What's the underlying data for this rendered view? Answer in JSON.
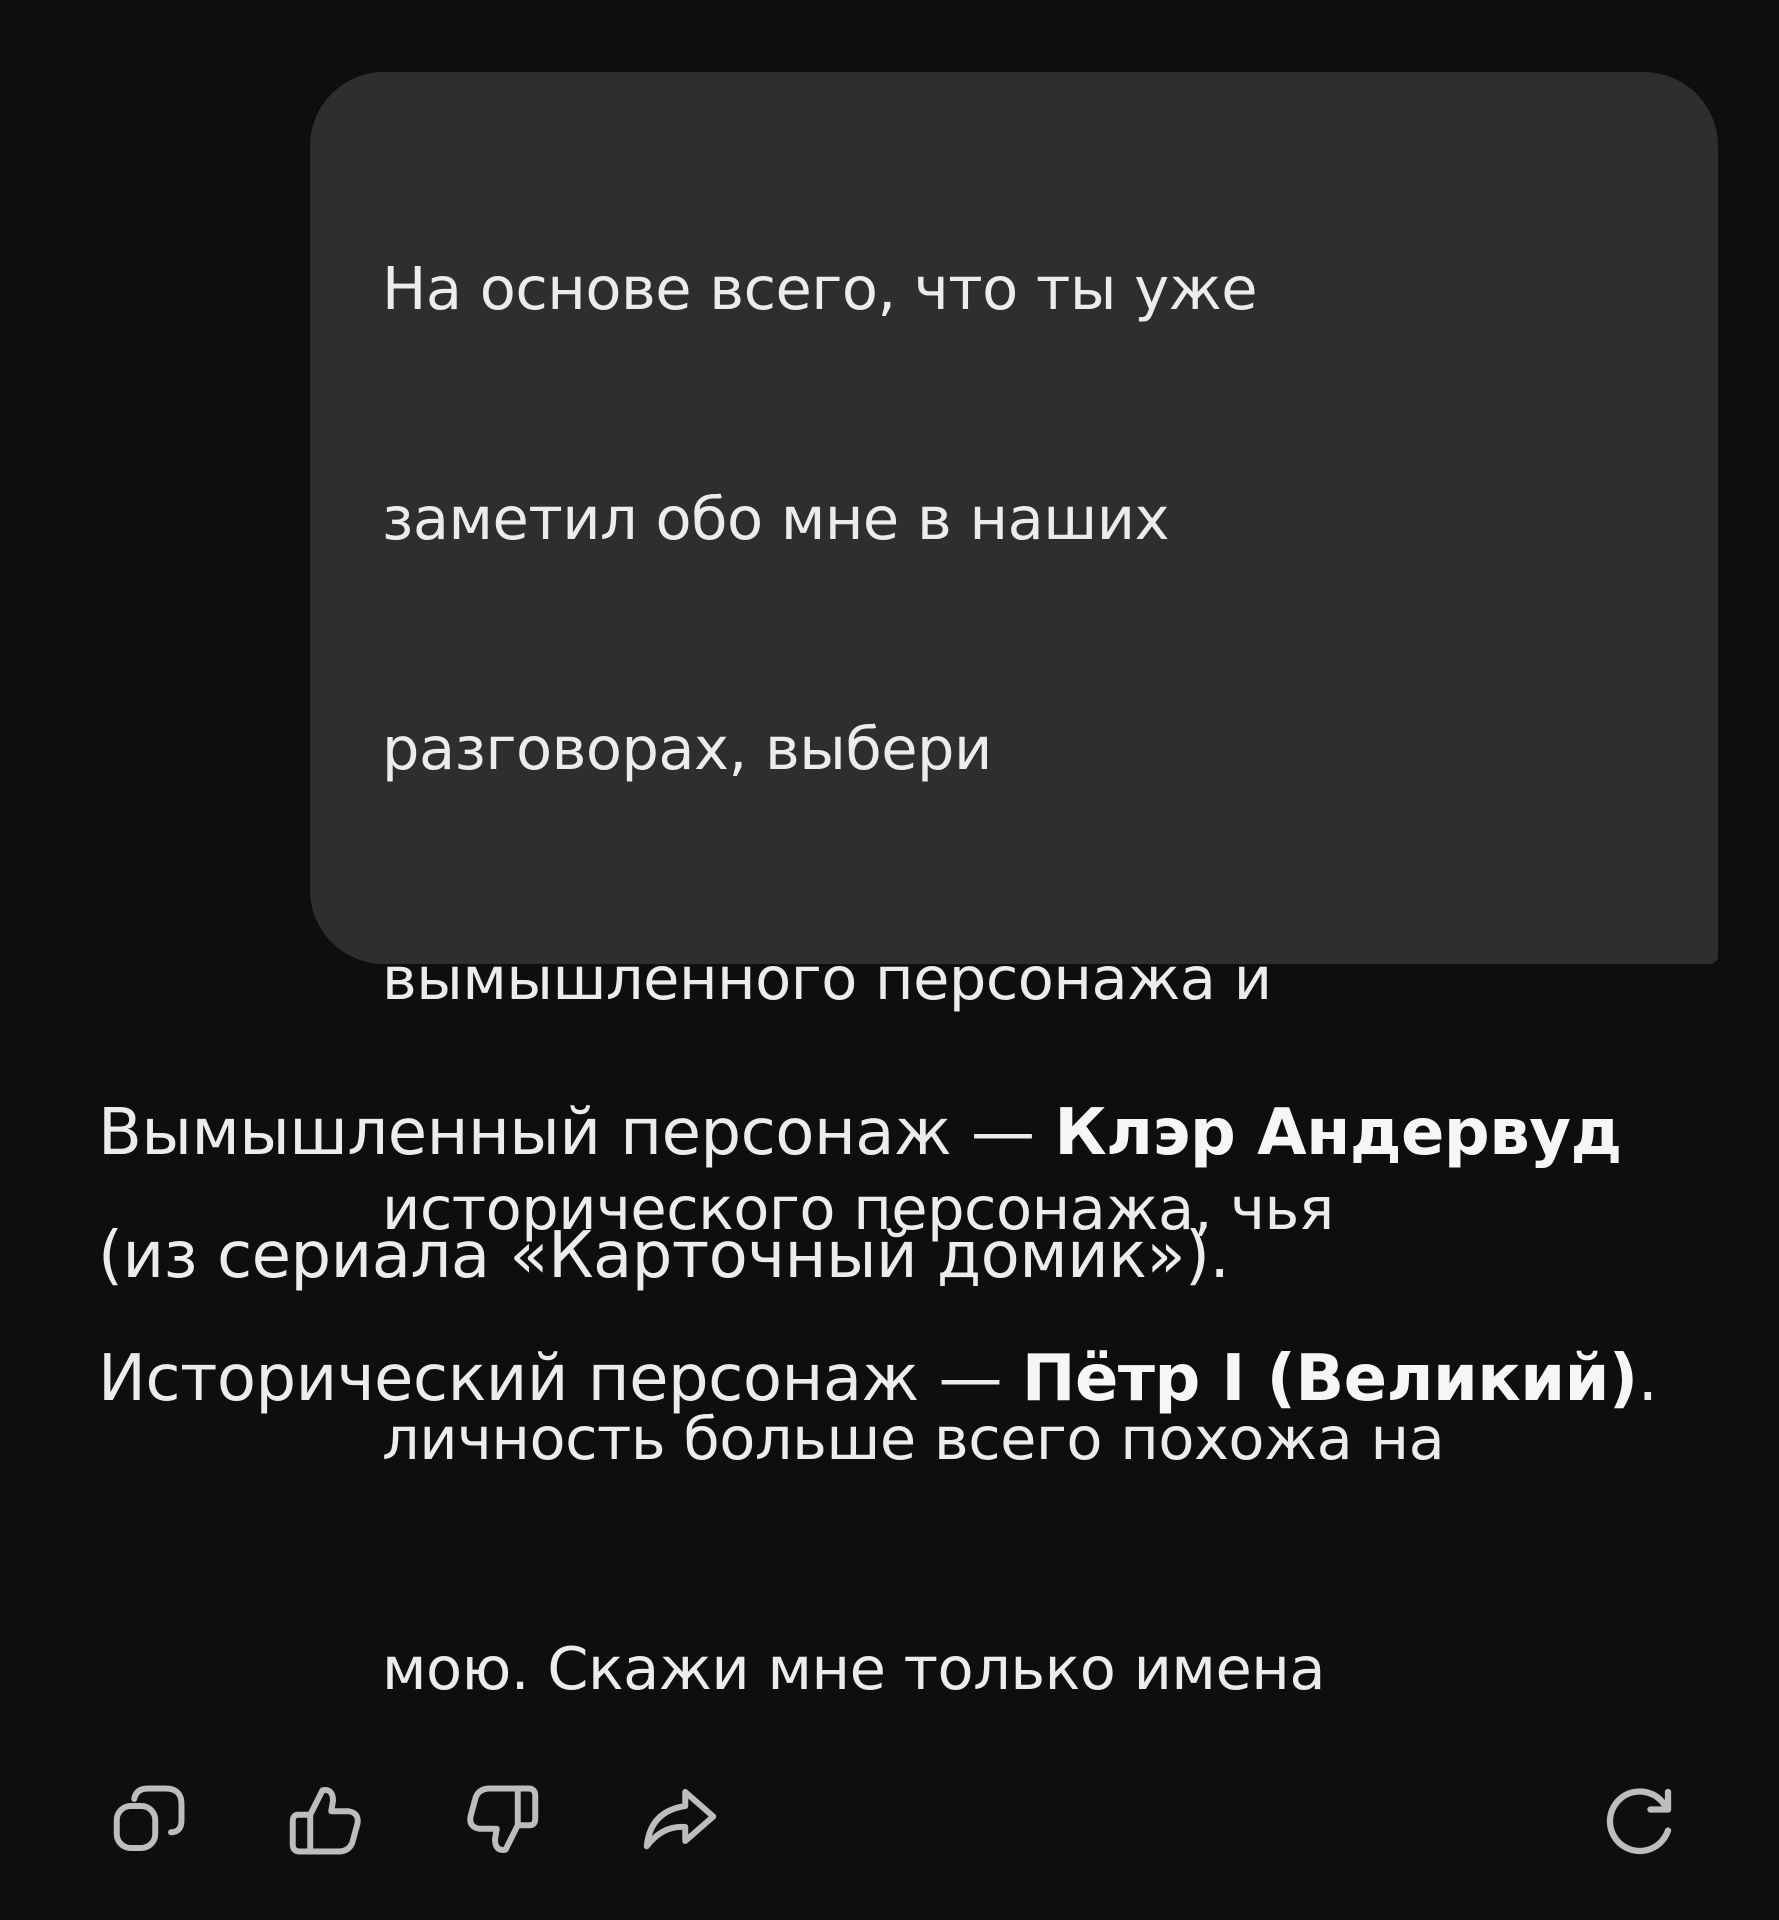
{
  "user_message": {
    "lines": [
      "На основе всего, что ты уже",
      "заметил обо мне в наших",
      "разговорах, выбери",
      "вымышленного персонажа и",
      "исторического персонажа, чья",
      "личность больше всего похожа на",
      "мою. Скажи мне только имена"
    ]
  },
  "assistant_reply": {
    "fictional_prefix": "Вымышленный персонаж — ",
    "fictional_name": "Клэр Андервуд",
    "fictional_suffix": " (из сериала «Карточный домик»).",
    "historical_prefix": "Исторический персонаж — ",
    "historical_name": "Пётр I (Великий)",
    "historical_suffix": "."
  },
  "actions": {
    "copy_icon": "copy-icon",
    "like_icon": "thumbs-up-icon",
    "dislike_icon": "thumbs-down-icon",
    "share_icon": "share-icon",
    "regenerate_icon": "refresh-icon"
  },
  "colors": {
    "background": "#0e0e0f",
    "bubble": "#2e2e30",
    "text": "#ececec",
    "icon": "#bdbdbd"
  }
}
